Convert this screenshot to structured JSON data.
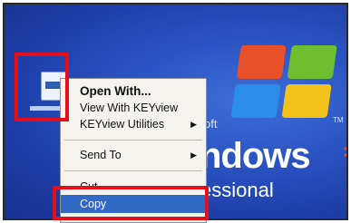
{
  "desktop": {
    "brand_fragment": "oft",
    "trademark": "TM",
    "windows_text": "ndows",
    "edition_text": "essional",
    "colors": {
      "background": "#2b55c4",
      "callout": "#e3101a",
      "selection": "#316ac5"
    }
  },
  "file_icon": {
    "name": "document-icon"
  },
  "context_menu": {
    "items": [
      {
        "label": "Open With...",
        "bold": true
      },
      {
        "label": "View With KEYview"
      },
      {
        "label": "KEYview Utilities",
        "submenu": true
      },
      {
        "label": "Send To",
        "submenu": true
      },
      {
        "label": "Cut"
      },
      {
        "label": "Copy",
        "selected": true
      }
    ],
    "submenu_arrow": "▶"
  }
}
